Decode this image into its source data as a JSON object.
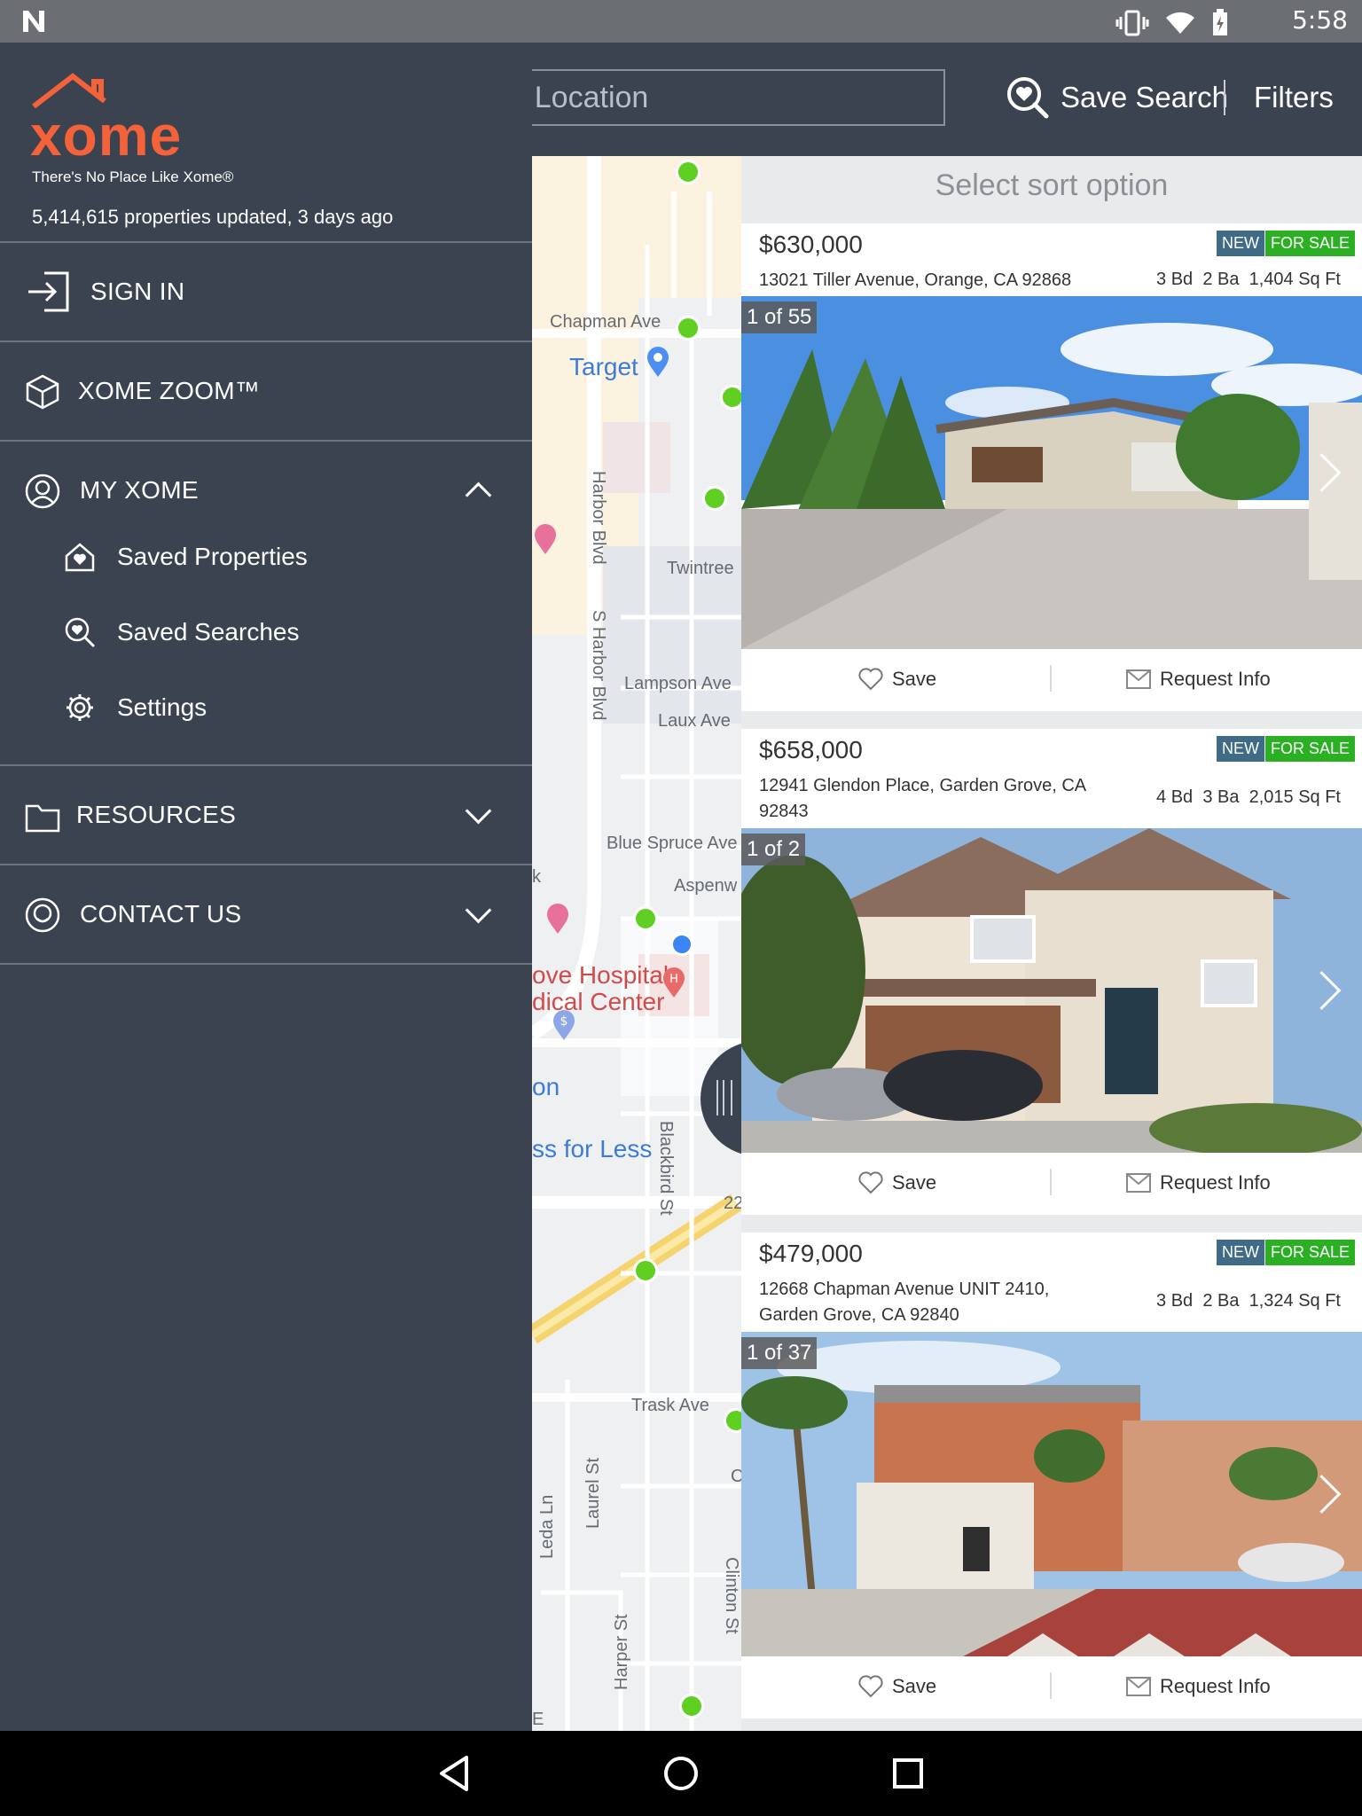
{
  "status_bar": {
    "time": "5:58"
  },
  "header": {
    "search_placeholder": "r Location",
    "save_search_label": "Save Search",
    "filters_label": "Filters"
  },
  "map": {
    "labels": [
      "Chapman Ave",
      "Target",
      "Harbor Blvd",
      "Twintree",
      "S Harbor Blvd",
      "Lampson Ave",
      "Laux Ave",
      "Blue Spruce Ave",
      "Aspenw",
      "ove Hospital",
      "dical Center",
      "on",
      "ss for Less",
      "Blackbird St",
      "Leda Ln",
      "Laurel St",
      "Trask Ave",
      "Clinton St",
      "Harper St",
      "C",
      "22",
      "E",
      "k"
    ]
  },
  "list": {
    "sort_label": "Select sort option",
    "listings": [
      {
        "price": "$630,000",
        "badge_new": "NEW",
        "badge_sale": "FOR SALE",
        "address": "13021 Tiller Avenue, Orange, CA 92868",
        "beds": "3 Bd",
        "baths": "2 Ba",
        "sqft": "1,404 Sq Ft",
        "photo_counter": "1 of 55",
        "save_label": "Save",
        "request_label": "Request Info"
      },
      {
        "price": "$658,000",
        "badge_new": "NEW",
        "badge_sale": "FOR SALE",
        "address": "12941 Glendon Place, Garden Grove, CA 92843",
        "beds": "4 Bd",
        "baths": "3 Ba",
        "sqft": "2,015 Sq Ft",
        "photo_counter": "1 of 2",
        "save_label": "Save",
        "request_label": "Request Info"
      },
      {
        "price": "$479,000",
        "badge_new": "NEW",
        "badge_sale": "FOR SALE",
        "address": "12668 Chapman Avenue UNIT 2410, Garden Grove, CA 92840",
        "beds": "3 Bd",
        "baths": "2 Ba",
        "sqft": "1,324 Sq Ft",
        "photo_counter": "1 of 37",
        "save_label": "Save",
        "request_label": "Request Info"
      }
    ]
  },
  "drawer": {
    "brand_name": "xome",
    "tagline": "There's No Place Like Xome®",
    "updated_text": "5,414,615 properties updated, 3 days ago",
    "sign_in": "SIGN IN",
    "xome_zoom": "XOME ZOOM™",
    "my_xome": "MY XOME",
    "saved_properties": "Saved Properties",
    "saved_searches": "Saved Searches",
    "settings": "Settings",
    "resources": "RESOURCES",
    "contact_us": "CONTACT US"
  },
  "colors": {
    "brand_orange": "#f4623a",
    "drawer_bg": "#3b4351",
    "badge_new": "#3f6b86",
    "badge_sale": "#2bb024",
    "map_pin_green": "#5fcf22"
  }
}
